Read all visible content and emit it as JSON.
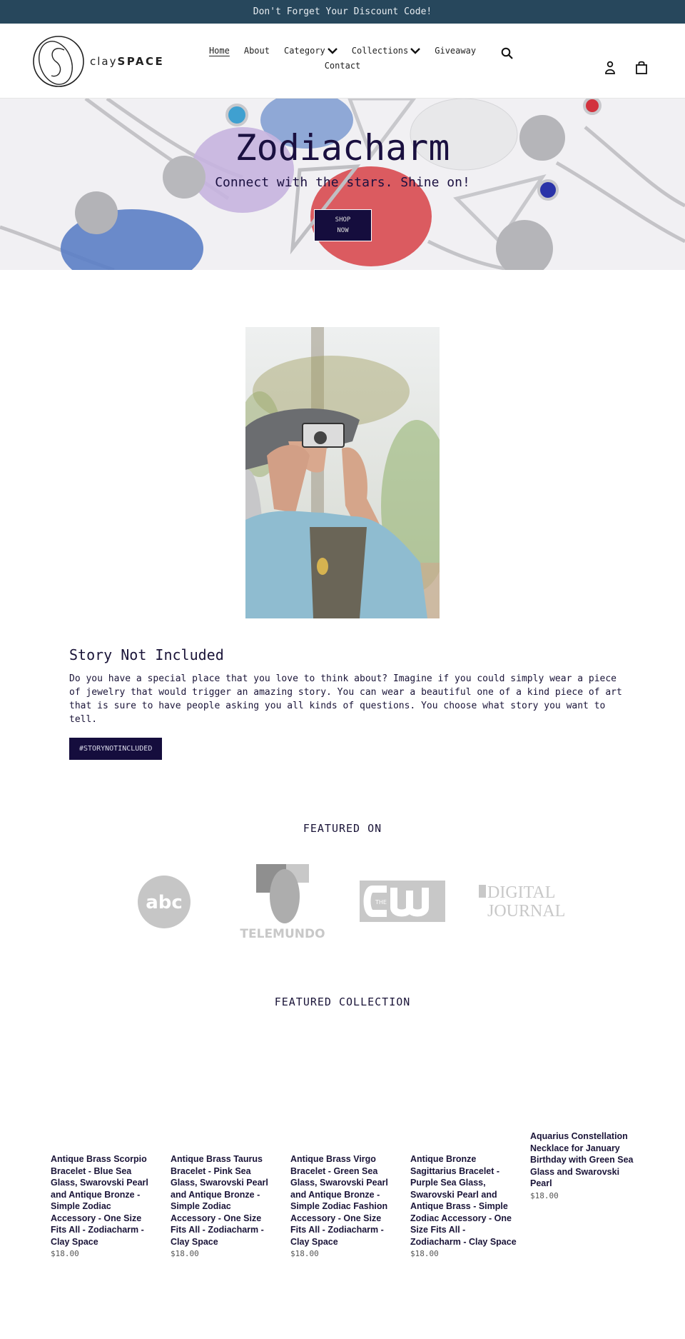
{
  "announcement": {
    "text": "Don't Forget Your Discount Code!"
  },
  "header": {
    "logo": {
      "text_light": "clay",
      "text_bold": "SPACE"
    },
    "nav": [
      {
        "label": "Home",
        "active": true,
        "dropdown": false
      },
      {
        "label": "About",
        "active": false,
        "dropdown": false
      },
      {
        "label": "Category",
        "active": false,
        "dropdown": true
      },
      {
        "label": "Collections",
        "active": false,
        "dropdown": true
      },
      {
        "label": "Giveaway",
        "active": false,
        "dropdown": false
      },
      {
        "label": "Contact",
        "active": false,
        "dropdown": false
      }
    ],
    "icons": [
      "search-icon",
      "account-icon",
      "cart-icon"
    ]
  },
  "hero": {
    "title": "Zodiacharm",
    "subtitle": "Connect with the stars. Shine on!",
    "button_line1": "SHOP",
    "button_line2": "NOW"
  },
  "story": {
    "heading": "Story Not Included",
    "body": "Do you have a special place that you love to think about?  Imagine if you could simply wear a piece of jewelry that would trigger an amazing story. You can wear a beautiful one of a kind piece of art that is sure to have people asking you all kinds of questions.  You choose what story you want to tell.",
    "button": "#STORYNOTINCLUDED"
  },
  "featured_on": {
    "title": "FEATURED ON",
    "logos": [
      {
        "name": "abc",
        "text": "abc"
      },
      {
        "name": "telemundo",
        "text": "TELEMUNDO"
      },
      {
        "name": "the-cw",
        "text": "THE"
      },
      {
        "name": "digital-journal",
        "line1": "DIGITAL",
        "line2": "JOURNAL"
      }
    ]
  },
  "featured_collection": {
    "title": "FEATURED COLLECTION",
    "products": [
      {
        "name": "Antique Brass Scorpio Bracelet - Blue Sea Glass, Swarovski Pearl and Antique Bronze - Simple Zodiac Accessory - One Size Fits All - Zodiacharm - Clay Space",
        "price": "$18.00"
      },
      {
        "name": "Antique Brass Taurus Bracelet - Pink Sea Glass, Swarovski Pearl and Antique Bronze - Simple Zodiac Accessory - One Size Fits All - Zodiacharm - Clay Space",
        "price": "$18.00"
      },
      {
        "name": "Antique Brass Virgo Bracelet - Green Sea Glass, Swarovski Pearl and Antique Bronze - Simple Zodiac Fashion Accessory - One Size Fits All - Zodiacharm - Clay Space",
        "price": "$18.00"
      },
      {
        "name": "Antique Bronze Sagittarius Bracelet - Purple Sea Glass, Swarovski Pearl and Antique Brass - Simple Zodiac Accessory - One Size Fits All - Zodiacharm - Clay Space",
        "price": "$18.00"
      },
      {
        "name": "Aquarius Constellation Necklace for January Birthday with Green Sea Glass and Swarovski Pearl",
        "price": "$18.00"
      }
    ]
  },
  "colors": {
    "announcement_bg": "#27475c",
    "button_bg": "#150d3d",
    "text": "#1a1438"
  }
}
